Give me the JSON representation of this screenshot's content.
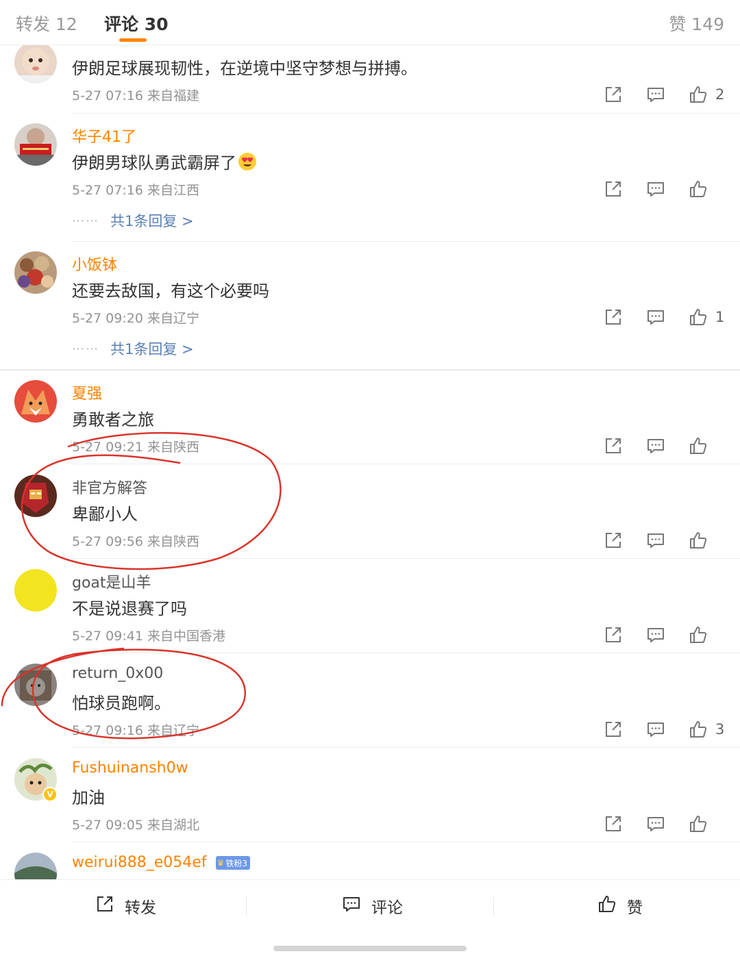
{
  "tabs": {
    "repost": "转发 12",
    "comments": "评论 30",
    "likes": "赞 149"
  },
  "comments": [
    {
      "user": "",
      "text": "伊朗足球展现韧性，在逆境中坚守梦想与拼搏。",
      "time": "5-27 07:16 来自福建",
      "likes": "2"
    },
    {
      "user": "华子41了",
      "text": "伊朗男球队勇武霸屏了",
      "emoji": "heart-eyes-emoji",
      "time": "5-27 07:16 来自江西",
      "likes": "",
      "replies": "共1条回复 >"
    },
    {
      "user": "小饭钵",
      "text": "还要去敌国，有这个必要吗",
      "time": "5-27 09:20 来自辽宁",
      "likes": "1",
      "replies": "共1条回复 >"
    },
    {
      "user": "夏强",
      "text": "勇敢者之旅",
      "time": "5-27 09:21 来自陕西",
      "likes": ""
    },
    {
      "user": "非官方解答",
      "text": "卑鄙小人",
      "time": "5-27 09:56 来自陕西",
      "likes": ""
    },
    {
      "user": "goat是山羊",
      "text": "不是说退赛了吗",
      "time": "5-27 09:41 来自中国香港",
      "likes": ""
    },
    {
      "user": "return_0x00",
      "text": "怕球员跑啊。",
      "time": "5-27 09:16 来自辽宁",
      "likes": "3"
    },
    {
      "user": "Fushuinansh0w",
      "text": "加油",
      "time": "5-27 09:05 来自湖北",
      "likes": "",
      "verified": "V"
    },
    {
      "user": "weirui888_e054ef",
      "badge": "铁粉3"
    }
  ],
  "reply_dots": "⋯⋯",
  "bottom_bar": {
    "repost": "转发",
    "comment": "评论",
    "like": "赞"
  },
  "colors": {
    "username": "#ff8200",
    "reply_link": "#5a7fb5",
    "annotation": "#d9342b"
  }
}
